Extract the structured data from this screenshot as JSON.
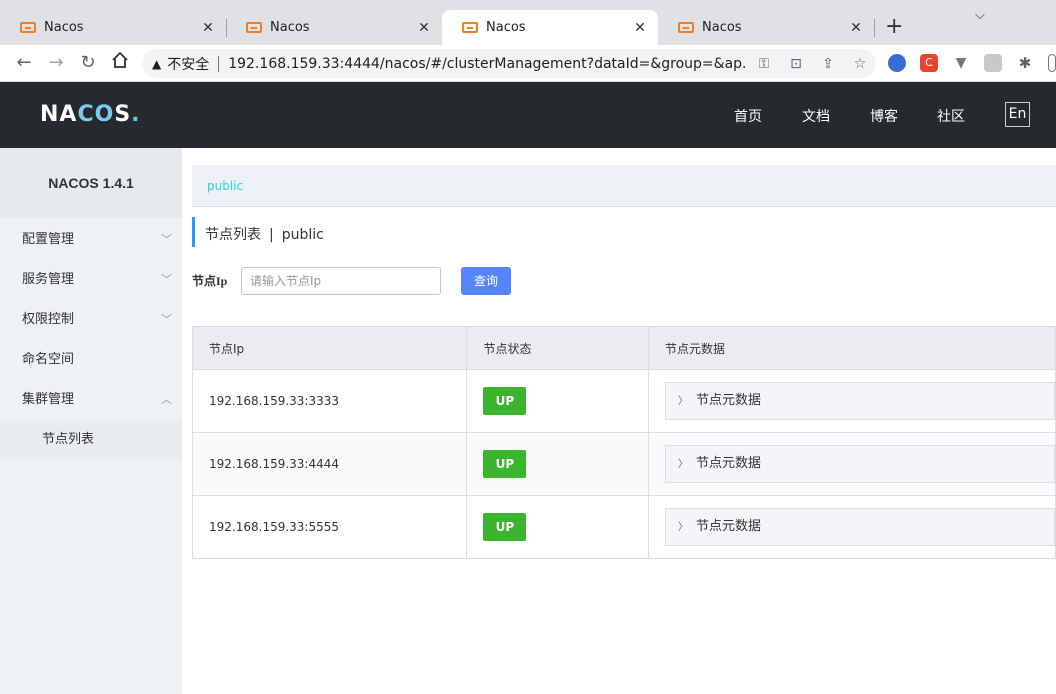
{
  "browser": {
    "tabs": [
      {
        "title": "Nacos",
        "close": "✕"
      },
      {
        "title": "Nacos",
        "close": "✕"
      },
      {
        "title": "Nacos",
        "close": "✕"
      },
      {
        "title": "Nacos",
        "close": "✕"
      }
    ],
    "new_tab": "+",
    "window_menu": "⌵",
    "address": {
      "security_label": "不安全",
      "url": "192.168.159.33:4444/nacos/#/clusterManagement?dataId=&group=&ap..."
    },
    "extensions": [
      "C"
    ]
  },
  "header": {
    "brand_prefix": "NA",
    "brand_c": "C",
    "brand_o": "O",
    "brand_s": "S",
    "brand_dot": ".",
    "nav": [
      "首页",
      "文档",
      "博客",
      "社区"
    ],
    "lang_button": "En"
  },
  "sidebar": {
    "title": "NACOS 1.4.1",
    "items": [
      {
        "label": "配置管理",
        "expanded": false
      },
      {
        "label": "服务管理",
        "expanded": false
      },
      {
        "label": "权限控制",
        "expanded": false
      },
      {
        "label": "命名空间"
      },
      {
        "label": "集群管理",
        "expanded": true
      }
    ],
    "sub_items": [
      "节点列表"
    ]
  },
  "main": {
    "namespace_crumb": "public",
    "page_title": "节点列表",
    "page_title_sep": "|",
    "page_title_namespace": "public",
    "filter": {
      "label": "节点Ip",
      "placeholder": "请输入节点Ip",
      "value": "",
      "button": "查询"
    },
    "table": {
      "columns": [
        "节点Ip",
        "节点状态",
        "节点元数据"
      ],
      "rows": [
        {
          "ip": "192.168.159.33:3333",
          "status": "UP",
          "meta": "节点元数据"
        },
        {
          "ip": "192.168.159.33:4444",
          "status": "UP",
          "meta": "节点元数据"
        },
        {
          "ip": "192.168.159.33:5555",
          "status": "UP",
          "meta": "节点元数据"
        }
      ]
    }
  },
  "colors": {
    "header_bg": "#252a2f",
    "accent_blue": "#5584ff",
    "status_up": "#3bb42e",
    "crumb": "#33cde5"
  }
}
